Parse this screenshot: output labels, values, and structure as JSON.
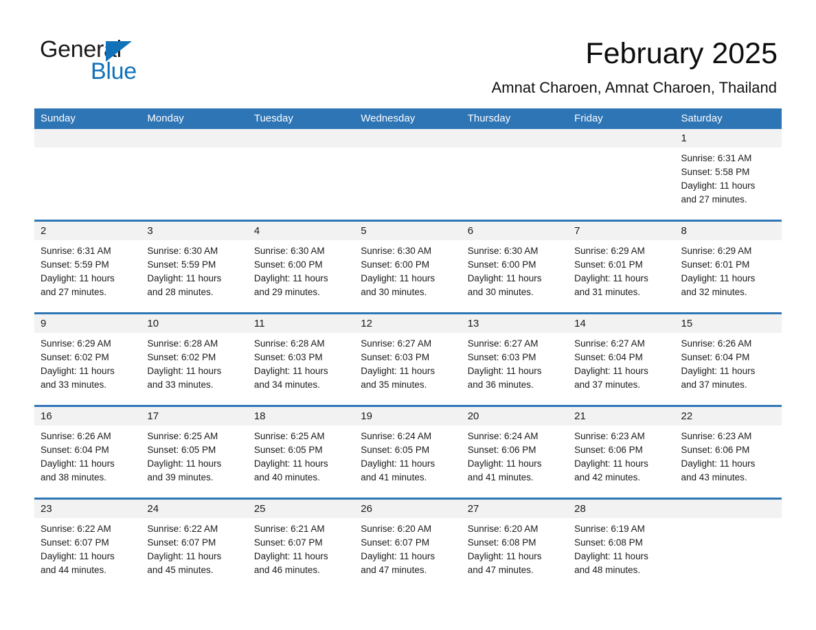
{
  "brand": {
    "name_part1": "General",
    "name_part2": "Blue",
    "accent_color": "#1172BA"
  },
  "header": {
    "title": "February 2025",
    "subtitle": "Amnat Charoen, Amnat Charoen, Thailand"
  },
  "theme": {
    "header_blue": "#2E75B6",
    "daynum_band": "#F2F2F2",
    "text": "#1a1a1a"
  },
  "calendar": {
    "day_names": [
      "Sunday",
      "Monday",
      "Tuesday",
      "Wednesday",
      "Thursday",
      "Friday",
      "Saturday"
    ],
    "weeks": [
      [
        {
          "day": "",
          "lines": []
        },
        {
          "day": "",
          "lines": []
        },
        {
          "day": "",
          "lines": []
        },
        {
          "day": "",
          "lines": []
        },
        {
          "day": "",
          "lines": []
        },
        {
          "day": "",
          "lines": []
        },
        {
          "day": "1",
          "lines": [
            "Sunrise: 6:31 AM",
            "Sunset: 5:58 PM",
            "Daylight: 11 hours",
            "and 27 minutes."
          ]
        }
      ],
      [
        {
          "day": "2",
          "lines": [
            "Sunrise: 6:31 AM",
            "Sunset: 5:59 PM",
            "Daylight: 11 hours",
            "and 27 minutes."
          ]
        },
        {
          "day": "3",
          "lines": [
            "Sunrise: 6:30 AM",
            "Sunset: 5:59 PM",
            "Daylight: 11 hours",
            "and 28 minutes."
          ]
        },
        {
          "day": "4",
          "lines": [
            "Sunrise: 6:30 AM",
            "Sunset: 6:00 PM",
            "Daylight: 11 hours",
            "and 29 minutes."
          ]
        },
        {
          "day": "5",
          "lines": [
            "Sunrise: 6:30 AM",
            "Sunset: 6:00 PM",
            "Daylight: 11 hours",
            "and 30 minutes."
          ]
        },
        {
          "day": "6",
          "lines": [
            "Sunrise: 6:30 AM",
            "Sunset: 6:00 PM",
            "Daylight: 11 hours",
            "and 30 minutes."
          ]
        },
        {
          "day": "7",
          "lines": [
            "Sunrise: 6:29 AM",
            "Sunset: 6:01 PM",
            "Daylight: 11 hours",
            "and 31 minutes."
          ]
        },
        {
          "day": "8",
          "lines": [
            "Sunrise: 6:29 AM",
            "Sunset: 6:01 PM",
            "Daylight: 11 hours",
            "and 32 minutes."
          ]
        }
      ],
      [
        {
          "day": "9",
          "lines": [
            "Sunrise: 6:29 AM",
            "Sunset: 6:02 PM",
            "Daylight: 11 hours",
            "and 33 minutes."
          ]
        },
        {
          "day": "10",
          "lines": [
            "Sunrise: 6:28 AM",
            "Sunset: 6:02 PM",
            "Daylight: 11 hours",
            "and 33 minutes."
          ]
        },
        {
          "day": "11",
          "lines": [
            "Sunrise: 6:28 AM",
            "Sunset: 6:03 PM",
            "Daylight: 11 hours",
            "and 34 minutes."
          ]
        },
        {
          "day": "12",
          "lines": [
            "Sunrise: 6:27 AM",
            "Sunset: 6:03 PM",
            "Daylight: 11 hours",
            "and 35 minutes."
          ]
        },
        {
          "day": "13",
          "lines": [
            "Sunrise: 6:27 AM",
            "Sunset: 6:03 PM",
            "Daylight: 11 hours",
            "and 36 minutes."
          ]
        },
        {
          "day": "14",
          "lines": [
            "Sunrise: 6:27 AM",
            "Sunset: 6:04 PM",
            "Daylight: 11 hours",
            "and 37 minutes."
          ]
        },
        {
          "day": "15",
          "lines": [
            "Sunrise: 6:26 AM",
            "Sunset: 6:04 PM",
            "Daylight: 11 hours",
            "and 37 minutes."
          ]
        }
      ],
      [
        {
          "day": "16",
          "lines": [
            "Sunrise: 6:26 AM",
            "Sunset: 6:04 PM",
            "Daylight: 11 hours",
            "and 38 minutes."
          ]
        },
        {
          "day": "17",
          "lines": [
            "Sunrise: 6:25 AM",
            "Sunset: 6:05 PM",
            "Daylight: 11 hours",
            "and 39 minutes."
          ]
        },
        {
          "day": "18",
          "lines": [
            "Sunrise: 6:25 AM",
            "Sunset: 6:05 PM",
            "Daylight: 11 hours",
            "and 40 minutes."
          ]
        },
        {
          "day": "19",
          "lines": [
            "Sunrise: 6:24 AM",
            "Sunset: 6:05 PM",
            "Daylight: 11 hours",
            "and 41 minutes."
          ]
        },
        {
          "day": "20",
          "lines": [
            "Sunrise: 6:24 AM",
            "Sunset: 6:06 PM",
            "Daylight: 11 hours",
            "and 41 minutes."
          ]
        },
        {
          "day": "21",
          "lines": [
            "Sunrise: 6:23 AM",
            "Sunset: 6:06 PM",
            "Daylight: 11 hours",
            "and 42 minutes."
          ]
        },
        {
          "day": "22",
          "lines": [
            "Sunrise: 6:23 AM",
            "Sunset: 6:06 PM",
            "Daylight: 11 hours",
            "and 43 minutes."
          ]
        }
      ],
      [
        {
          "day": "23",
          "lines": [
            "Sunrise: 6:22 AM",
            "Sunset: 6:07 PM",
            "Daylight: 11 hours",
            "and 44 minutes."
          ]
        },
        {
          "day": "24",
          "lines": [
            "Sunrise: 6:22 AM",
            "Sunset: 6:07 PM",
            "Daylight: 11 hours",
            "and 45 minutes."
          ]
        },
        {
          "day": "25",
          "lines": [
            "Sunrise: 6:21 AM",
            "Sunset: 6:07 PM",
            "Daylight: 11 hours",
            "and 46 minutes."
          ]
        },
        {
          "day": "26",
          "lines": [
            "Sunrise: 6:20 AM",
            "Sunset: 6:07 PM",
            "Daylight: 11 hours",
            "and 47 minutes."
          ]
        },
        {
          "day": "27",
          "lines": [
            "Sunrise: 6:20 AM",
            "Sunset: 6:08 PM",
            "Daylight: 11 hours",
            "and 47 minutes."
          ]
        },
        {
          "day": "28",
          "lines": [
            "Sunrise: 6:19 AM",
            "Sunset: 6:08 PM",
            "Daylight: 11 hours",
            "and 48 minutes."
          ]
        },
        {
          "day": "",
          "lines": []
        }
      ]
    ]
  }
}
